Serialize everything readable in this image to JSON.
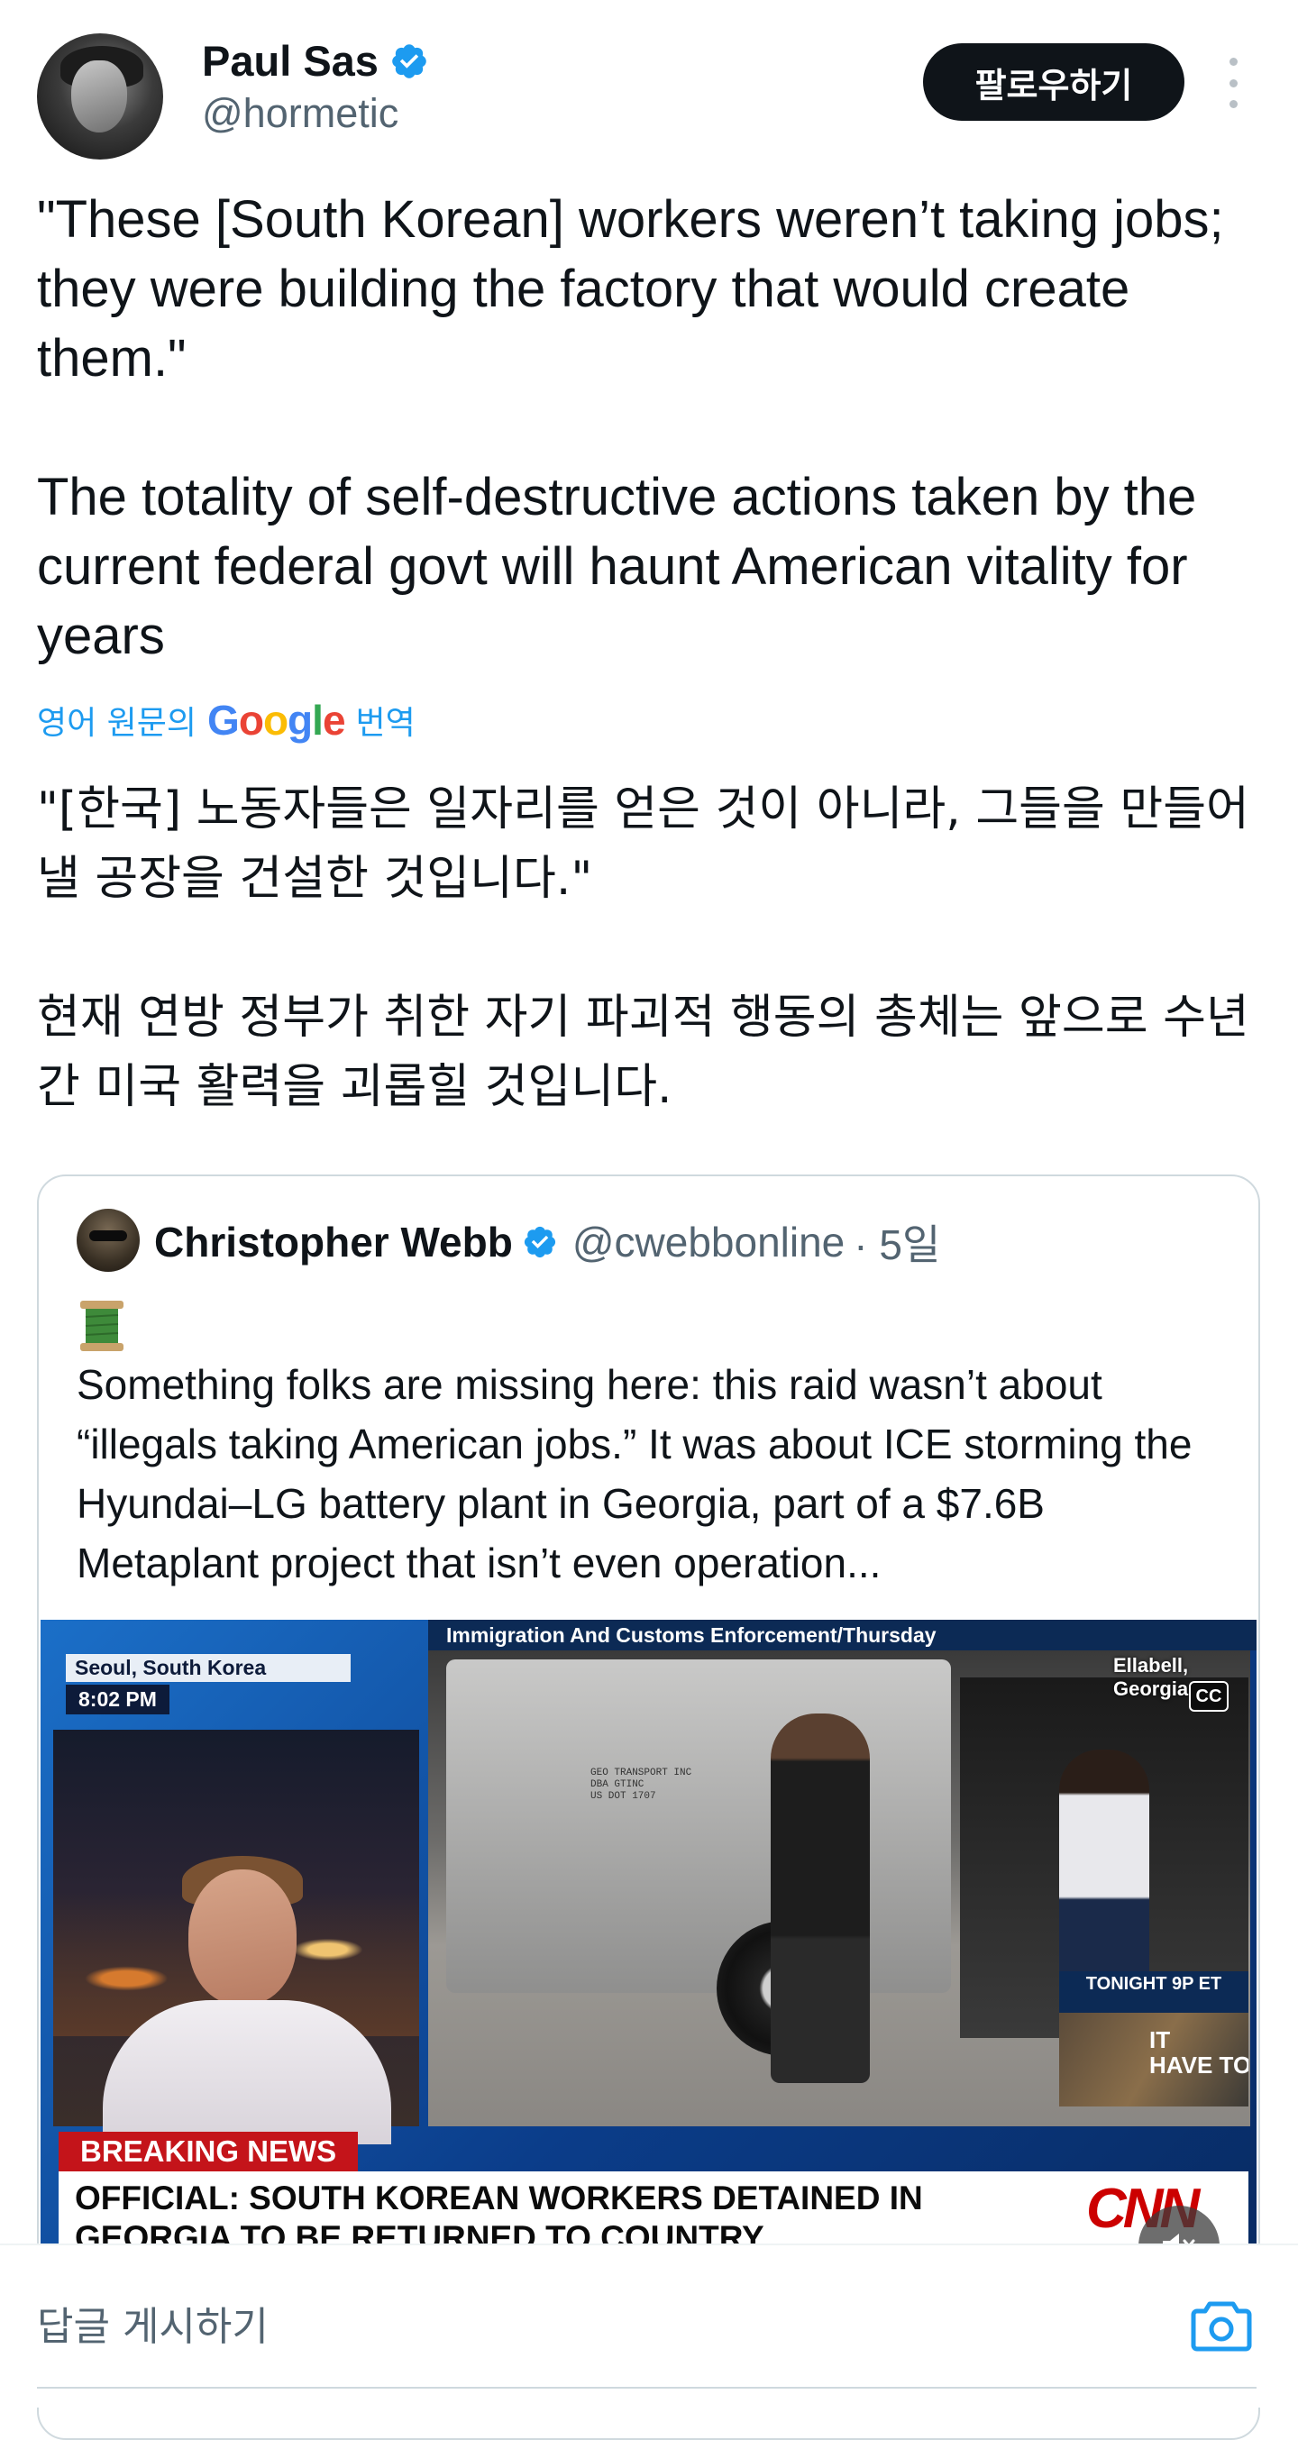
{
  "author": {
    "name": "Paul Sas",
    "handle": "@hormetic",
    "follow_label": "팔로우하기"
  },
  "tweet": {
    "text": "\"These [South Korean] workers weren’t taking jobs; they were building the factory that would create them.\"\n\nThe totality of self-destructive actions taken by the current federal govt will haunt American vitality for years",
    "translate_prefix": "영어 원문의",
    "translate_brand": "Google",
    "translate_suffix": "번역",
    "translated_text": "\"[한국] 노동자들은 일자리를 얻은 것이 아니라, 그들을 만들어낼 공장을 건설한 것입니다.\"\n\n현재 연방 정부가 취한 자기 파괴적 행동의 총체는 앞으로 수년간 미국 활력을 괴롭힐 것입니다."
  },
  "quoted": {
    "name": "Christopher Webb",
    "handle": "@cwebbonline",
    "time": "· 5일",
    "emoji": "spool-of-thread",
    "text": "Something folks are missing here: this raid wasn’t about “illegals taking American jobs.” It was about ICE storming the Hyundai–LG battery plant in Georgia, part of a $7.6B Metaplant project that isn’t even operation...",
    "video": {
      "location": "Seoul, South Korea",
      "time": "8:02 PM",
      "top_banner": "Immigration And Customs Enforcement/Thursday",
      "place": "Ellabell, Georgia",
      "cc_label": "CC",
      "bus_text": "GEO TRANSPORT INC\nDBA GTINC\nUS DOT 1707",
      "promo_time": "TONIGHT 9P ET",
      "promo_title": "IT\nHAVE TO HURT",
      "breaking_label": "BREAKING NEWS",
      "headline": "OFFICIAL: SOUTH KOREAN WORKERS DETAINED IN GEORGIA TO BE RETURNED TO COUNTRY",
      "network": "CNN"
    }
  },
  "reply": {
    "placeholder": "답글 게시하기"
  },
  "colors": {
    "accent": "#1d9bf0",
    "text": "#0f1419",
    "muted": "#536471",
    "breaking": "#c4141a"
  }
}
